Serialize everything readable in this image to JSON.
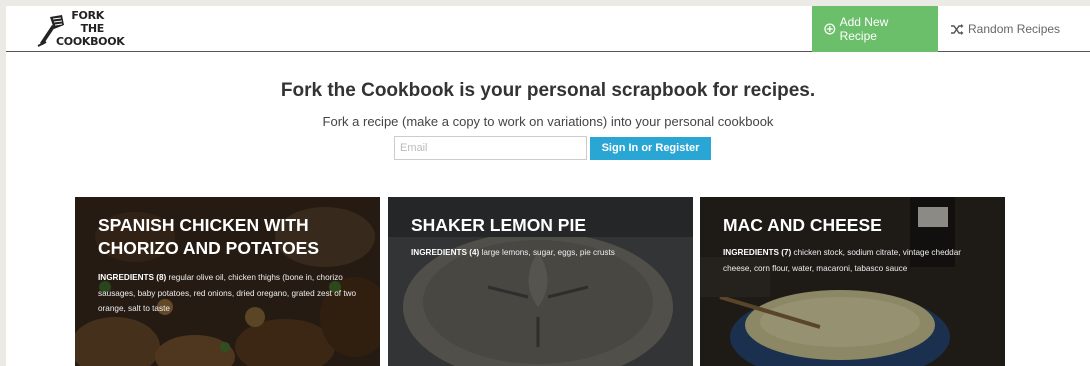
{
  "brand": {
    "logo_line1": "FORK",
    "logo_line2": "THE",
    "logo_line3": "COOKBOOK"
  },
  "nav": {
    "add_new_recipe": "Add New Recipe",
    "random_recipes": "Random Recipes",
    "add_icon": "plus-circle-icon",
    "random_icon": "shuffle-icon"
  },
  "hero": {
    "title": "Fork the Cookbook is your personal scrapbook for recipes.",
    "subtitle": "Fork a recipe (make a copy to work on variations) into your personal cookbook",
    "email_placeholder": "Email",
    "signin_label": "Sign In or Register"
  },
  "colors": {
    "accent_green": "#6cbf6a",
    "accent_blue": "#2aa6d4"
  },
  "recipes": [
    {
      "title": "SPANISH CHICKEN WITH CHORIZO AND POTATOES",
      "ingredients_label": "INGREDIENTS (8)",
      "ingredients": "regular olive oil, chicken thighs (bone in, chorizo sausages, baby potatoes, red onions, dried oregano, grated zest of two orange, salt to taste"
    },
    {
      "title": "SHAKER LEMON PIE",
      "ingredients_label": "INGREDIENTS (4)",
      "ingredients": "large lemons, sugar, eggs, pie crusts"
    },
    {
      "title": "MAC AND CHEESE",
      "ingredients_label": "INGREDIENTS (7)",
      "ingredients": "chicken stock, sodium citrate, vintage cheddar cheese, corn flour, water, macaroni, tabasco sauce"
    }
  ]
}
